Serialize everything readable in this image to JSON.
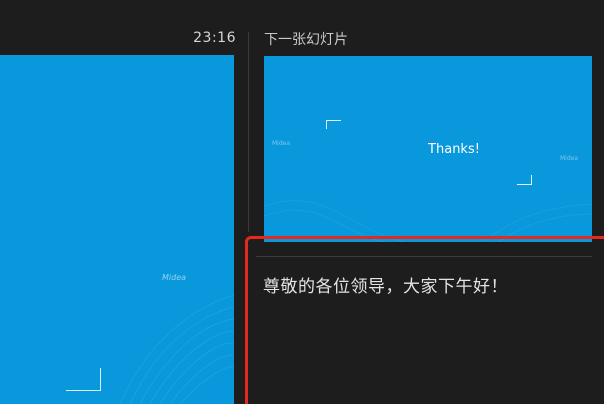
{
  "presenter": {
    "timer": "23:16",
    "next_label": "下一张幻灯片",
    "current_slide": {
      "logo_text": "Midea",
      "background": "#0a98dc"
    },
    "next_slide": {
      "title": "Thanks!",
      "logo_text": "Midea",
      "background": "#0a98dc"
    },
    "notes": "尊敬的各位领导，大家下午好！",
    "highlight_color": "#e42a1f"
  }
}
